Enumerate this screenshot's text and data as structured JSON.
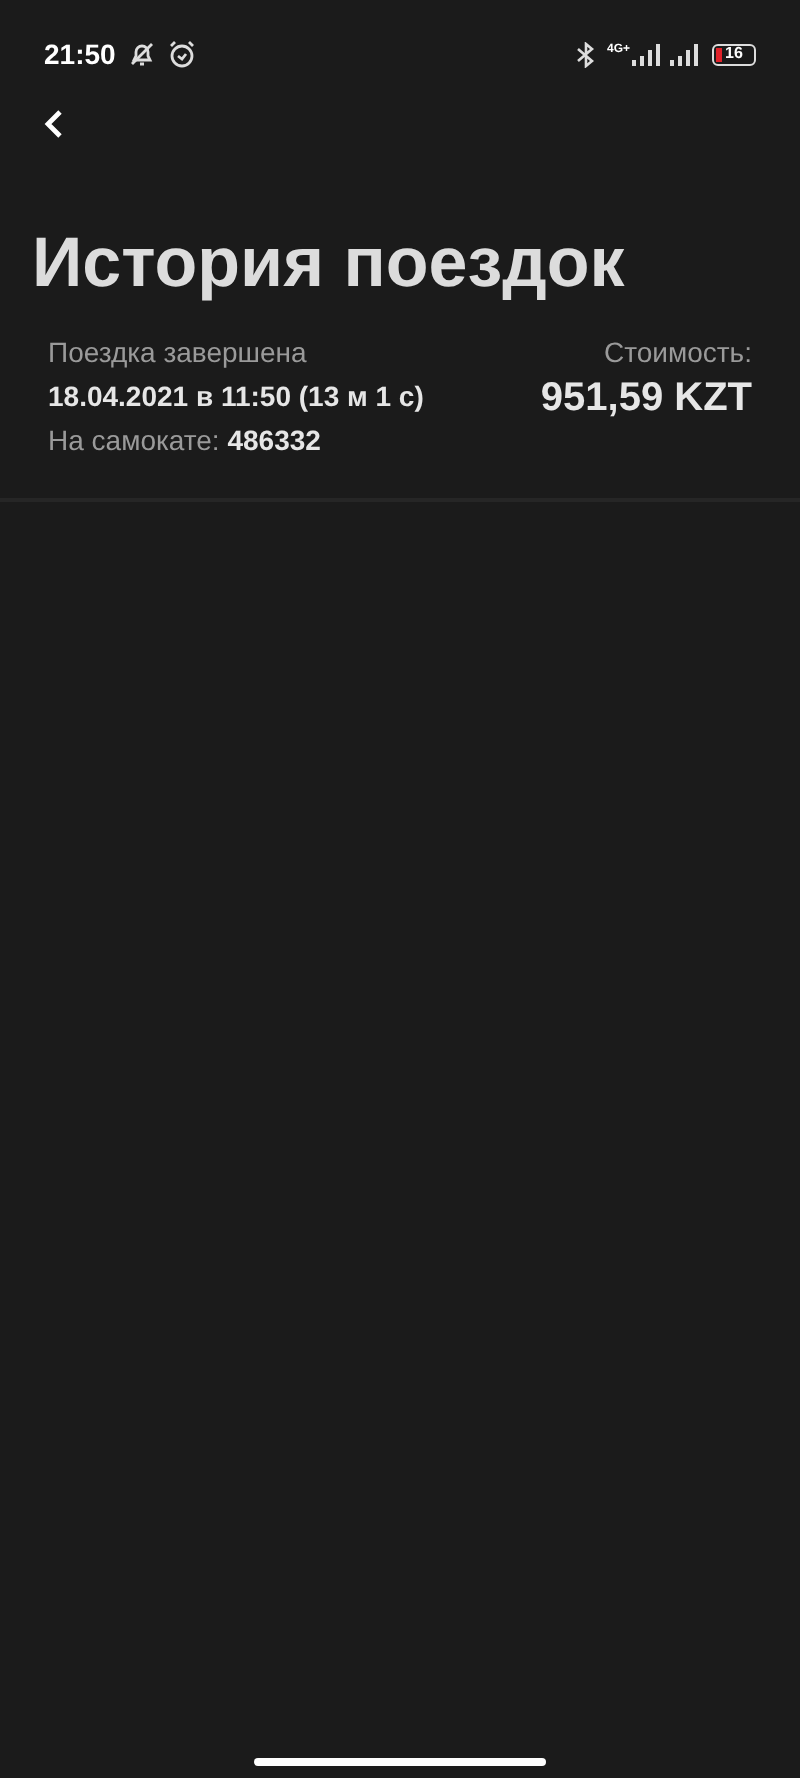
{
  "status_bar": {
    "time": "21:50",
    "network": "4G+",
    "battery": "16"
  },
  "title": "История поездок",
  "trips": [
    {
      "status": "Поездка завершена",
      "datetime": "18.04.2021 в 11:50 (13 м 1 с)",
      "scooter": "На самокате: **486332**",
      "cost_label": "Стоимость:",
      "cost": "951,59 KZT"
    }
  ]
}
